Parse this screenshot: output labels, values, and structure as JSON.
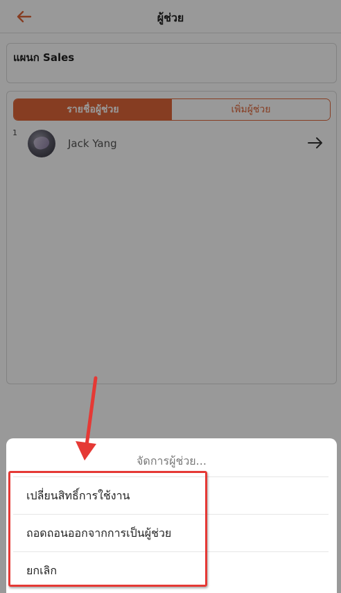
{
  "header": {
    "title": "ผู้ช่วย",
    "back_icon": "arrow-left-icon"
  },
  "department": {
    "name": "แผนก Sales"
  },
  "tabs": [
    {
      "label": "รายชื่อผู้ช่วย",
      "active": true
    },
    {
      "label": "เพิ่มผู้ช่วย",
      "active": false
    }
  ],
  "assistants": [
    {
      "index": "1",
      "name": "Jack Yang",
      "action_icon": "arrow-right-icon"
    }
  ],
  "action_sheet": {
    "title": "จัดการผู้ช่วย...",
    "options": [
      {
        "label": "เปลี่ยนสิทธิ์การใช้งาน"
      },
      {
        "label": "ถอดถอนออกจากการเป็นผู้ช่วย"
      },
      {
        "label": "ยกเลิก"
      }
    ]
  },
  "colors": {
    "accent": "#e0673a",
    "annotation": "#e53935"
  }
}
